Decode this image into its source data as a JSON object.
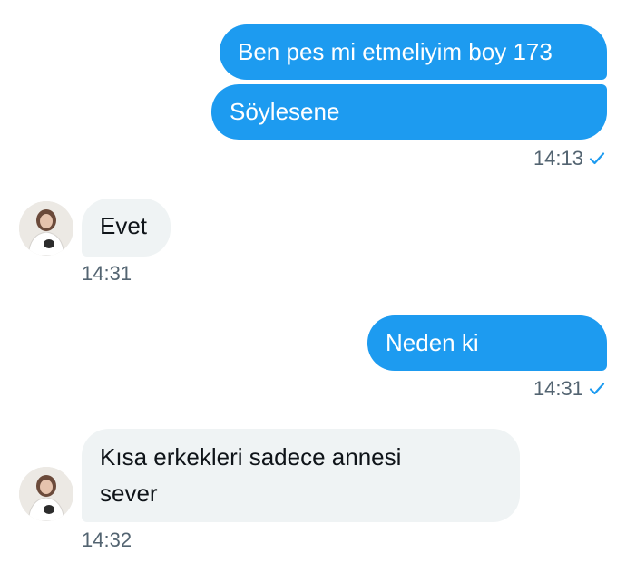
{
  "conversation": {
    "sent_group_1": {
      "messages": [
        "Ben pes mi etmeliyim boy 173",
        "Söylesene"
      ],
      "time": "14:13"
    },
    "received_1": {
      "text": "Evet",
      "time": "14:31"
    },
    "sent_2": {
      "text": "Neden ki",
      "time": "14:31"
    },
    "received_2": {
      "line1": "Kısa erkekleri sadece annesi",
      "line2": "sever",
      "time": "14:32"
    }
  },
  "colors": {
    "sent_bubble": "#1d9bf0",
    "received_bubble": "#eff3f4",
    "timestamp": "#536471",
    "read_check": "#1d9bf0"
  },
  "icons": [
    "read-check-icon",
    "contact-avatar"
  ]
}
